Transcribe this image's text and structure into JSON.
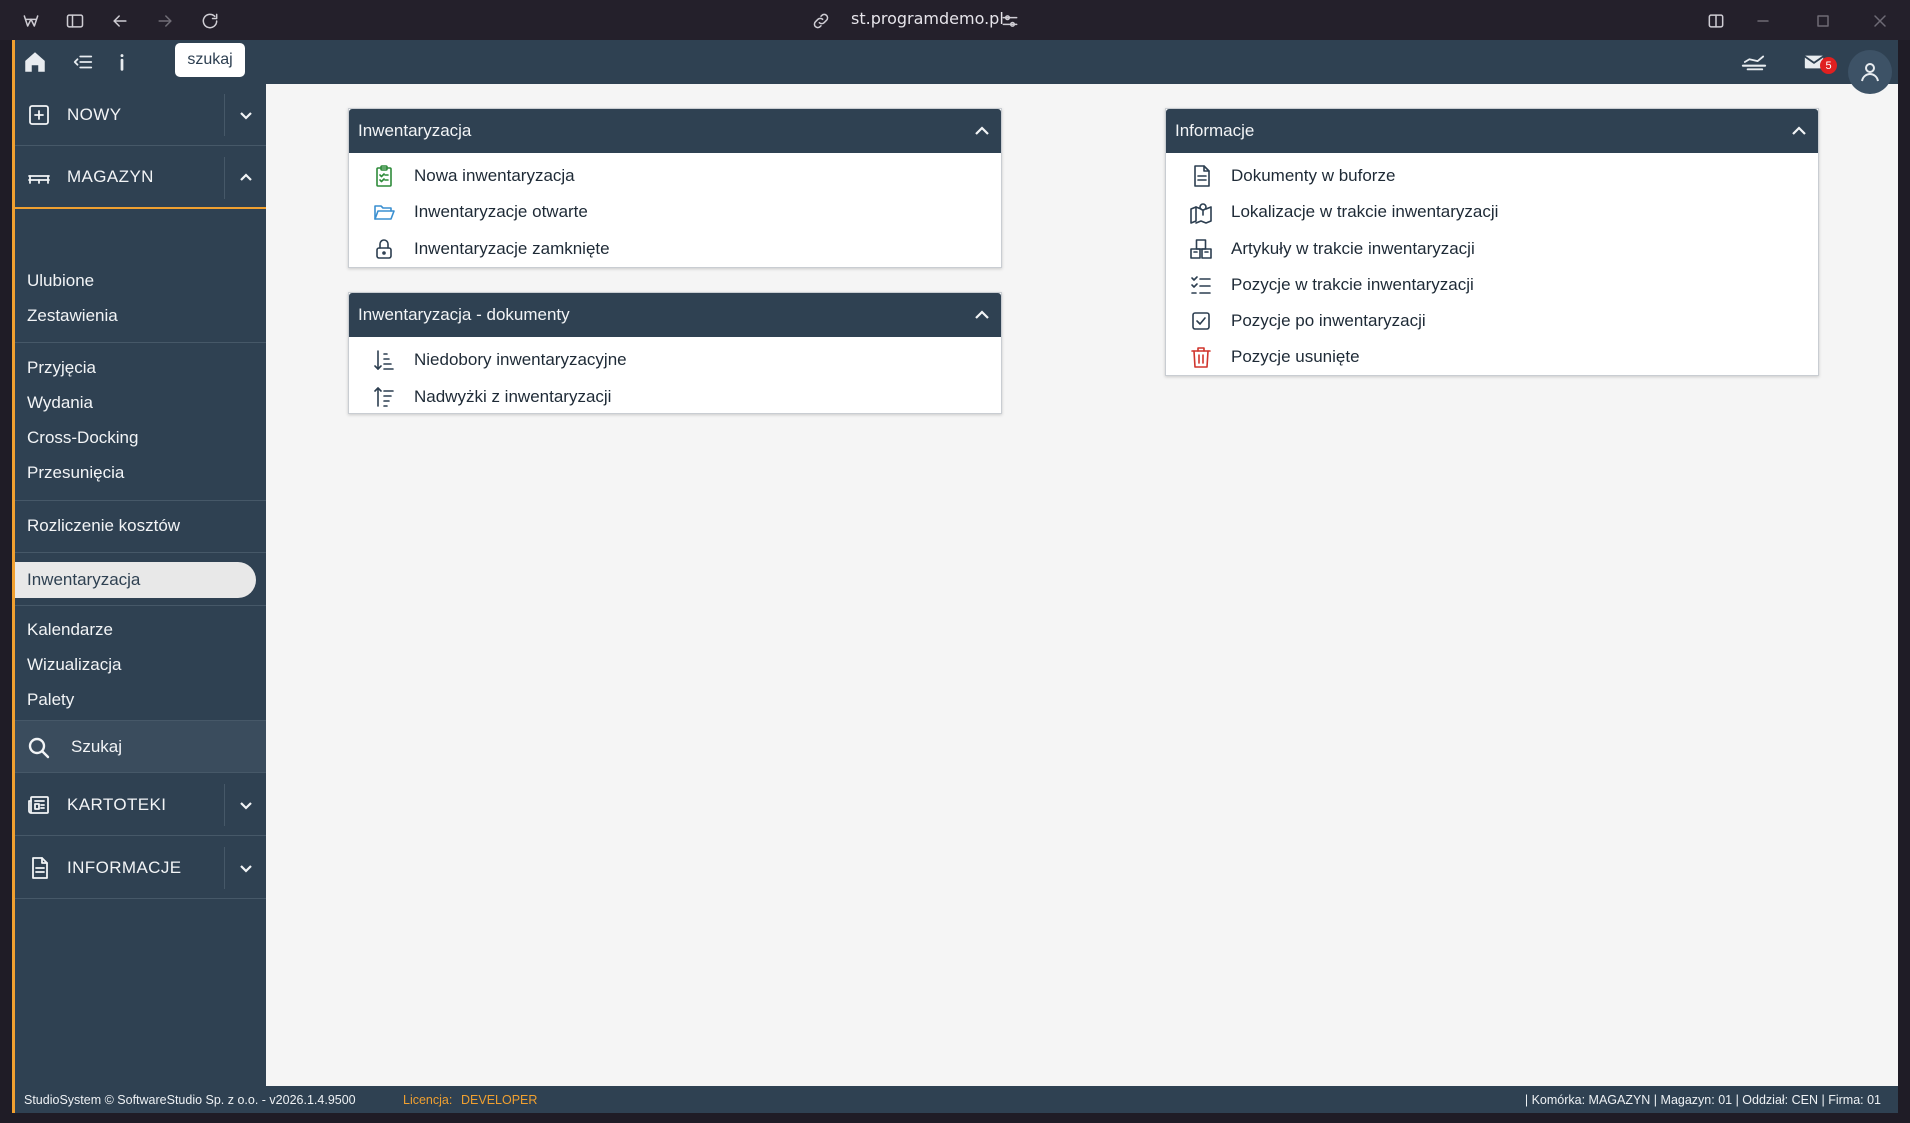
{
  "browser": {
    "url": "st.programdemo.pl"
  },
  "topbar": {
    "search_label": "szukaj",
    "mail_badge": "5"
  },
  "sidebar": {
    "sections": {
      "nowy": "NOWY",
      "magazyn": "MAGAZYN",
      "szukaj": "Szukaj",
      "kartoteki": "KARTOTEKI",
      "informacje": "INFORMACJE"
    },
    "items": [
      "Ulubione",
      "Zestawienia",
      "Przyjęcia",
      "Wydania",
      "Cross-Docking",
      "Przesunięcia",
      "Rozliczenie kosztów",
      "Inwentaryzacja",
      "Kalendarze",
      "Wizualizacja",
      "Palety"
    ]
  },
  "panels": {
    "inwentaryzacja": {
      "title": "Inwentaryzacja",
      "rows": [
        "Nowa inwentaryzacja",
        "Inwentaryzacje otwarte",
        "Inwentaryzacje zamknięte"
      ]
    },
    "dokumenty": {
      "title": "Inwentaryzacja - dokumenty",
      "rows": [
        "Niedobory inwentaryzacyjne",
        "Nadwyżki z inwentaryzacji"
      ]
    },
    "informacje": {
      "title": "Informacje",
      "rows": [
        "Dokumenty w buforze",
        "Lokalizacje w trakcie inwentaryzacji",
        "Artykuły w trakcie inwentaryzacji",
        "Pozycje w trakcie inwentaryzacji",
        "Pozycje po inwentaryzacji",
        "Pozycje usunięte"
      ]
    }
  },
  "footer": {
    "copyright": "StudioSystem © SoftwareStudio Sp. z o.o. - v2026.1.4.9500",
    "license_label": "Licencja:",
    "license_value": "DEVELOPER",
    "status": "| Komórka: MAGAZYN | Magazyn: 01 | Oddział: CEN | Firma: 01"
  },
  "colors": {
    "primary": "#2f4152",
    "accent": "#f0a030",
    "active_item_bg": "#e8e8e8",
    "badge": "#e02020",
    "icon_green": "#2e8b3a",
    "icon_blue": "#3a8fd0",
    "icon_red": "#d0342c"
  }
}
